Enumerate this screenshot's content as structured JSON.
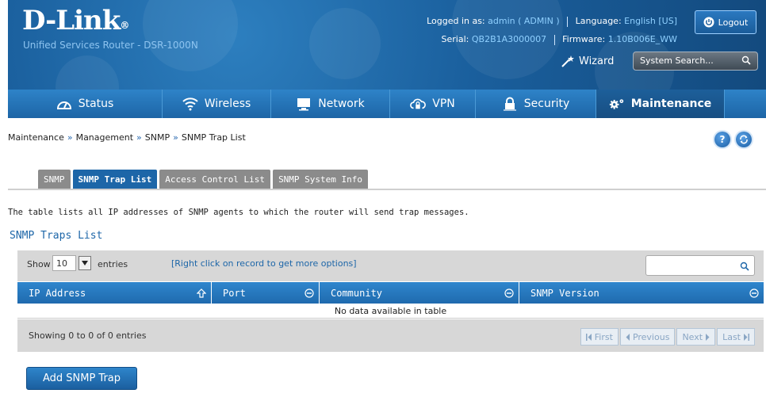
{
  "header": {
    "brand": "D-Link",
    "brand_mark": "®",
    "subtitle": "Unified Services Router - DSR-1000N",
    "logged_in_label": "Logged in as:",
    "logged_in_value": "admin ( ADMIN )",
    "language_label": "Language:",
    "language_value": "English [US]",
    "serial_label": "Serial:",
    "serial_value": "QB2B1A3000007",
    "firmware_label": "Firmware:",
    "firmware_value": "1.10B006E_WW",
    "logout_label": "Logout",
    "wizard_label": "Wizard",
    "search_placeholder": "System Search..."
  },
  "nav": {
    "items": [
      {
        "label": "Status",
        "icon": "gauge-icon"
      },
      {
        "label": "Wireless",
        "icon": "wifi-icon"
      },
      {
        "label": "Network",
        "icon": "monitor-icon"
      },
      {
        "label": "VPN",
        "icon": "cloud-lock-icon"
      },
      {
        "label": "Security",
        "icon": "lock-icon"
      },
      {
        "label": "Maintenance",
        "icon": "gears-icon"
      }
    ],
    "active": "Maintenance"
  },
  "breadcrumb": [
    "Maintenance",
    "Management",
    "SNMP",
    "SNMP Trap List"
  ],
  "breadcrumb_sep": "»",
  "help": {
    "help_icon": "?",
    "refresh_icon": "refresh-icon"
  },
  "tabs": [
    {
      "label": "SNMP",
      "active": false
    },
    {
      "label": "SNMP Trap List",
      "active": true
    },
    {
      "label": "Access Control List",
      "active": false
    },
    {
      "label": "SNMP System Info",
      "active": false
    }
  ],
  "description": "The table lists all IP addresses of SNMP agents to which the router will send trap messages.",
  "section_title": "SNMP Traps List",
  "table": {
    "show_label": "Show",
    "entries_value": "10",
    "entries_label": "entries",
    "hint": "[Right click on record to get more options]",
    "columns": [
      "IP Address",
      "Port",
      "Community",
      "SNMP Version"
    ],
    "empty_message": "No data available in table",
    "summary": "Showing 0 to 0 of 0 entries",
    "pager": {
      "first": "First",
      "previous": "Previous",
      "next": "Next",
      "last": "Last"
    }
  },
  "add_button_label": "Add SNMP Trap",
  "colors": {
    "primary": "#1d66a8",
    "header_bg": "#1a5f9d",
    "tab_inactive": "#8b8b8b",
    "panel_grey": "#d7d7d7"
  }
}
